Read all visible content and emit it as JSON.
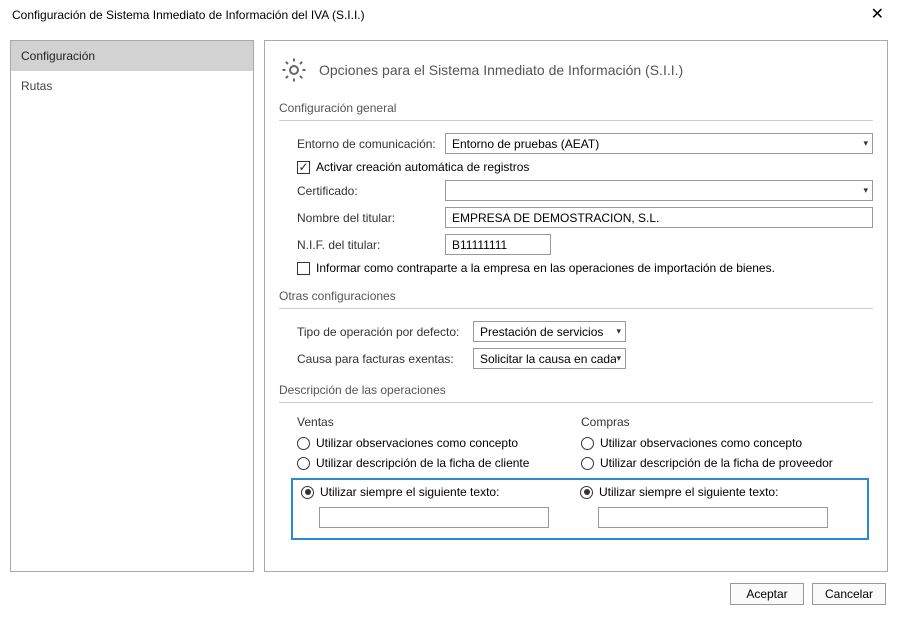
{
  "window": {
    "title": "Configuración de Sistema Inmediato de Información del IVA (S.I.I.)",
    "close_glyph": "✕"
  },
  "sidebar": {
    "items": [
      {
        "label": "Configuración"
      },
      {
        "label": "Rutas"
      }
    ]
  },
  "header": {
    "title": "Opciones para el Sistema Inmediato de Información (S.I.I.)"
  },
  "sections": {
    "general": {
      "heading": "Configuración general",
      "env_label": "Entorno de comunicación:",
      "env_value": "Entorno de pruebas (AEAT)",
      "auto_create_label": "Activar creación automática de registros",
      "cert_label": "Certificado:",
      "cert_value": "",
      "holder_name_label": "Nombre del titular:",
      "holder_name_value": "EMPRESA DE DEMOSTRACION, S.L.",
      "holder_nif_label": "N.I.F. del titular:",
      "holder_nif_value": "B11111111",
      "inform_counterpart_label": "Informar como contraparte a la empresa en las operaciones de importación de bienes."
    },
    "other": {
      "heading": "Otras configuraciones",
      "op_type_label": "Tipo de operación por defecto:",
      "op_type_value": "Prestación de servicios",
      "exempt_cause_label": "Causa para facturas exentas:",
      "exempt_cause_value": "Solicitar la causa en cada"
    },
    "desc": {
      "heading": "Descripción de las operaciones",
      "sales": {
        "heading": "Ventas",
        "opt1": "Utilizar observaciones como concepto",
        "opt2": "Utilizar descripción de la ficha de cliente",
        "opt3": "Utilizar siempre el siguiente texto:",
        "text_value": ""
      },
      "purchases": {
        "heading": "Compras",
        "opt1": "Utilizar observaciones como concepto",
        "opt2": "Utilizar descripción de la ficha de proveedor",
        "opt3": "Utilizar siempre el siguiente texto:",
        "text_value": ""
      }
    }
  },
  "buttons": {
    "accept": "Aceptar",
    "cancel": "Cancelar"
  },
  "glyphs": {
    "check": "✓",
    "dropdown": "▾"
  }
}
